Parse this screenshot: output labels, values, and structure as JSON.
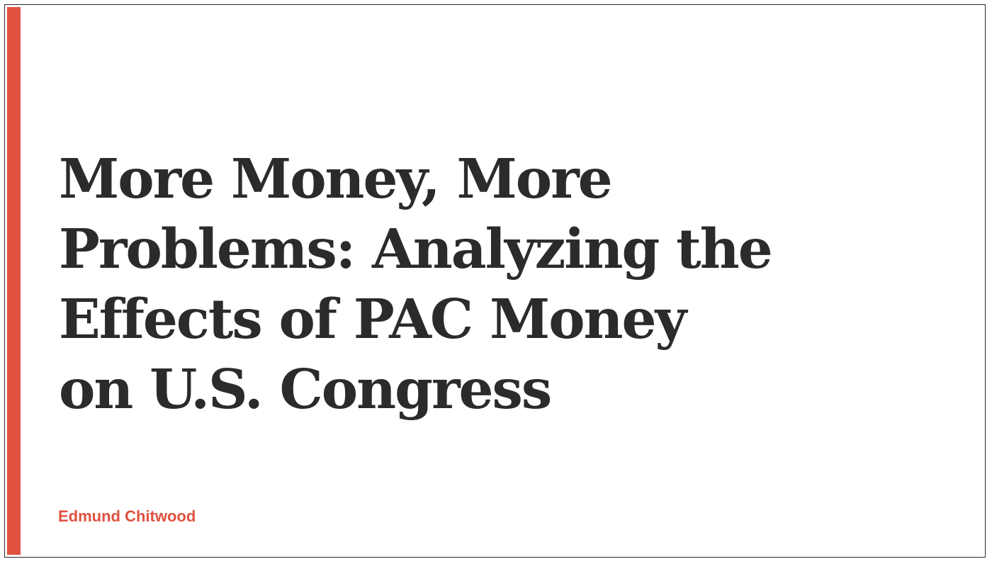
{
  "slide": {
    "title_lines": [
      "More Money, More",
      "Problems: Analyzing the",
      "Effects of PAC Money",
      "on U.S. Congress"
    ],
    "author": "Edmund Chitwood"
  },
  "colors": {
    "accent": "#e05140",
    "title_text": "#2b2b2b",
    "background": "#ffffff"
  }
}
